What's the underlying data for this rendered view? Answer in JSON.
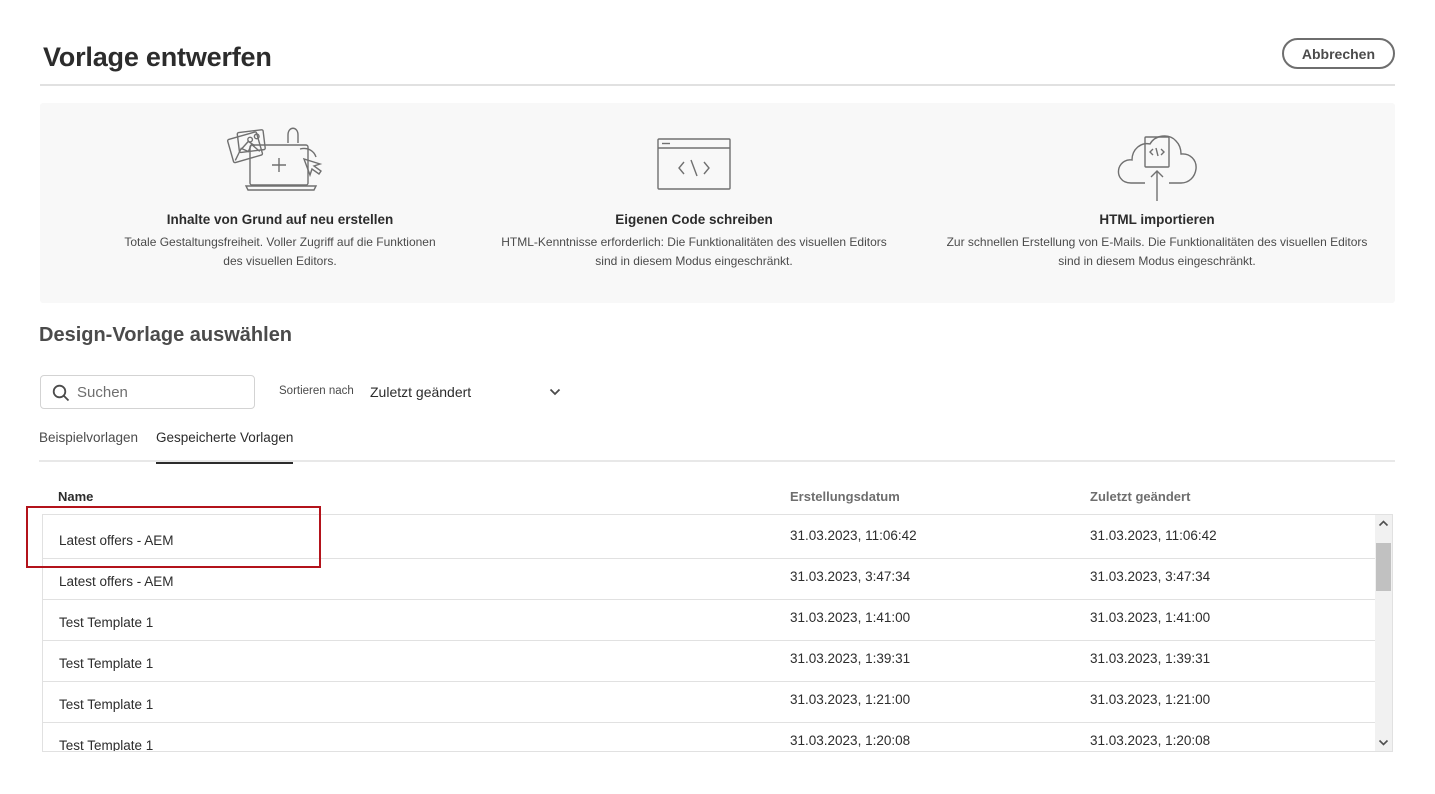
{
  "header": {
    "title": "Vorlage entwerfen",
    "cancel_label": "Abbrechen"
  },
  "options": [
    {
      "title": "Inhalte von Grund auf neu erstellen",
      "desc_line1": "Totale Gestaltungsfreiheit. Voller Zugriff auf die Funktionen",
      "desc_line2": "des visuellen Editors.",
      "icon": "design-canvas-illustration"
    },
    {
      "title": "Eigenen Code schreiben",
      "desc_line1": "HTML-Kenntnisse erforderlich: Die Funktionalitäten des visuellen Editors",
      "desc_line2": "sind in diesem Modus eingeschränkt.",
      "icon": "code-window-illustration"
    },
    {
      "title": "HTML importieren",
      "desc_line1": "Zur schnellen Erstellung von E-Mails. Die Funktionalitäten des visuellen Editors",
      "desc_line2": "sind in diesem Modus eingeschränkt.",
      "icon": "cloud-upload-illustration"
    }
  ],
  "section_title": "Design-Vorlage auswählen",
  "search": {
    "placeholder": "Suchen",
    "icon": "search-icon"
  },
  "sort": {
    "label": "Sortieren nach",
    "selected": "Zuletzt geändert",
    "icon": "chevron-down-icon"
  },
  "tabs": [
    {
      "label": "Beispielvorlagen",
      "active": false
    },
    {
      "label": "Gespeicherte Vorlagen",
      "active": true
    }
  ],
  "table": {
    "columns": [
      "Name",
      "Erstellungsdatum",
      "Zuletzt geändert"
    ],
    "rows": [
      {
        "name": "Latest offers - AEM",
        "created": "31.03.2023, 11:06:42",
        "modified": "31.03.2023, 11:06:42"
      },
      {
        "name": "Latest offers - AEM",
        "created": "31.03.2023, 3:47:34",
        "modified": "31.03.2023, 3:47:34"
      },
      {
        "name": "Test Template 1",
        "created": "31.03.2023, 1:41:00",
        "modified": "31.03.2023, 1:41:00"
      },
      {
        "name": "Test Template 1",
        "created": "31.03.2023, 1:39:31",
        "modified": "31.03.2023, 1:39:31"
      },
      {
        "name": "Test Template 1",
        "created": "31.03.2023, 1:21:00",
        "modified": "31.03.2023, 1:21:00"
      },
      {
        "name": "Test Template 1",
        "created": "31.03.2023, 1:20:08",
        "modified": "31.03.2023, 1:20:08"
      }
    ]
  },
  "colors": {
    "highlight": "#b3131b",
    "panel_bg": "#f8f8f8",
    "text": "#2c2c2c"
  }
}
